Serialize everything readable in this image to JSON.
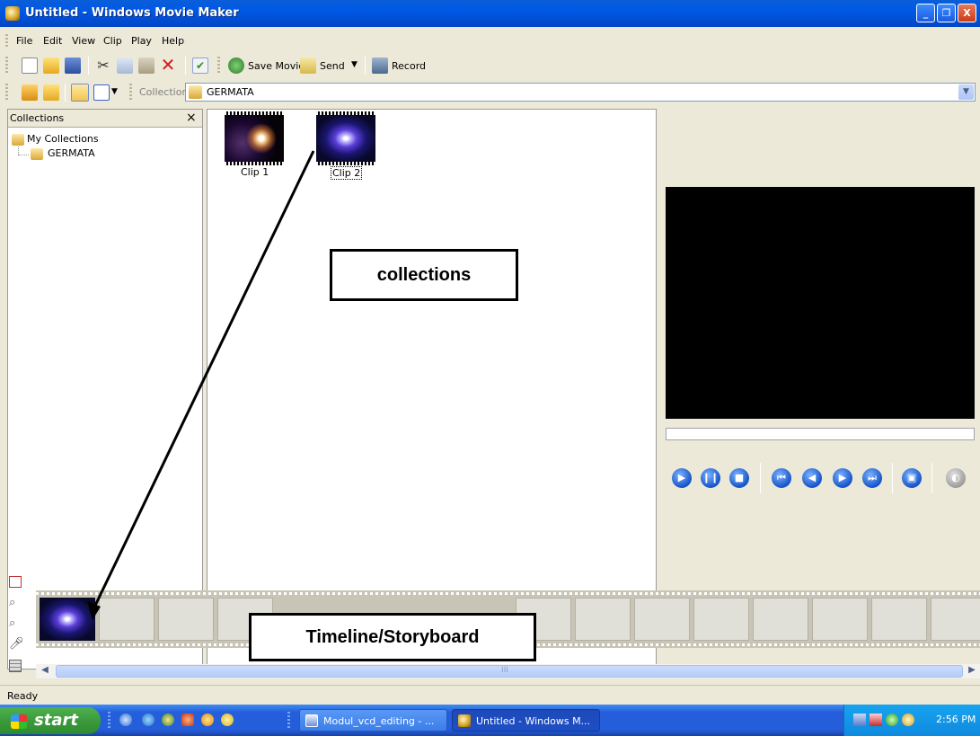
{
  "window": {
    "title": "Untitled - Windows Movie Maker",
    "minimize_glyph": "_",
    "maximize_glyph": "❐",
    "close_glyph": "X"
  },
  "menu": {
    "items": [
      "File",
      "Edit",
      "View",
      "Clip",
      "Play",
      "Help"
    ]
  },
  "toolbar": {
    "save_movie": "Save Movie",
    "send": "Send",
    "record": "Record"
  },
  "collection_bar": {
    "label": "Collection",
    "selected": "GERMATA"
  },
  "collections_pane": {
    "header": "Collections",
    "close_glyph": "×",
    "root": "My Collections",
    "child": "GERMATA"
  },
  "clips": [
    {
      "label": "Clip 1",
      "thumb": "lens-flare"
    },
    {
      "label": "Clip 2",
      "thumb": "blue-burst"
    }
  ],
  "annotations": {
    "collections": "collections",
    "timeline": "Timeline/Storyboard"
  },
  "scrollbar": {
    "grip": "III"
  },
  "status": {
    "text": "Ready"
  },
  "taskbar": {
    "start": "start",
    "tasks": [
      {
        "label": "Modul_vcd_editing - ...",
        "active": false
      },
      {
        "label": "Untitled - Windows M...",
        "active": true
      }
    ],
    "clock": "2:56 PM"
  },
  "colors": {
    "titlebar": "#0058e6",
    "taskbar": "#245edb",
    "chrome": "#ece9d8",
    "preview": "#000000"
  }
}
